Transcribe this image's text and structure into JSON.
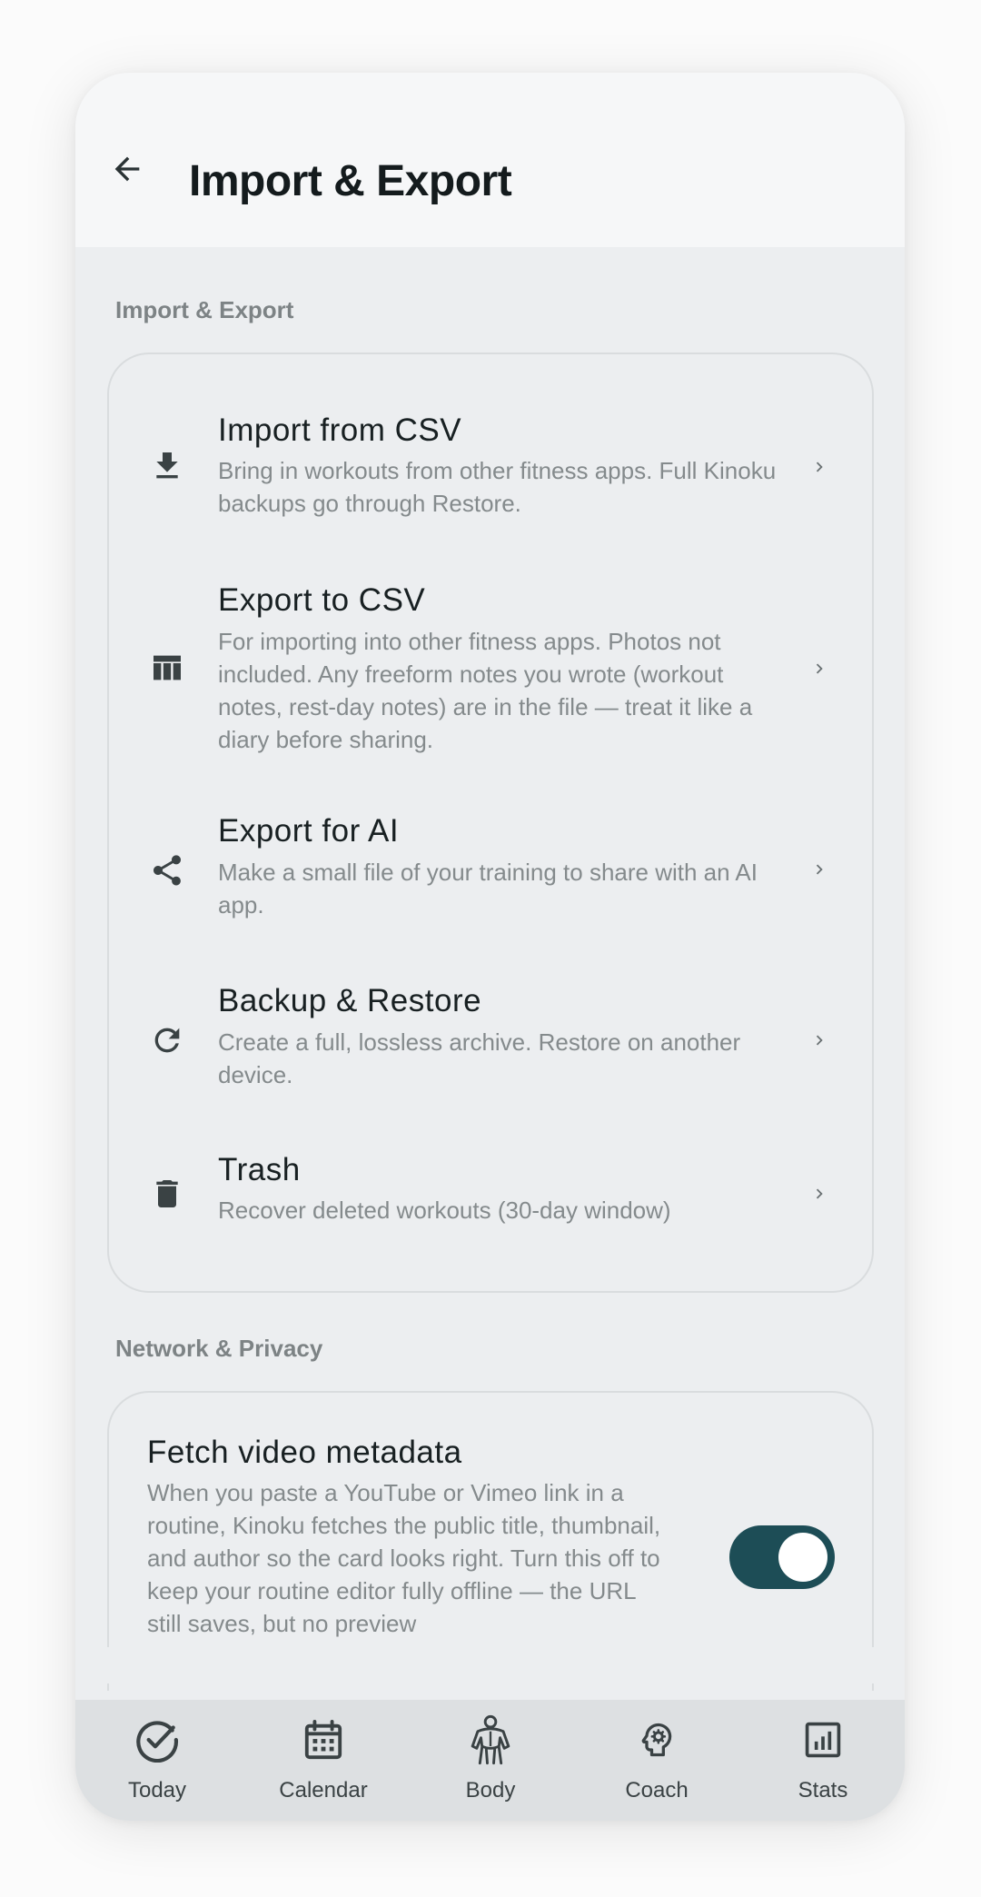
{
  "header": {
    "title": "Import & Export",
    "back_icon": "arrow-back-icon"
  },
  "sections": {
    "import_export_label": "Import & Export",
    "network_privacy_label": "Network & Privacy"
  },
  "rows": [
    {
      "icon": "download-icon",
      "title": "Import from CSV",
      "desc": "Bring in workouts from other fitness apps. Full Kinoku backups go through Restore."
    },
    {
      "icon": "table-icon",
      "title": "Export to CSV",
      "desc": "For importing into other fitness apps. Photos not included. Any freeform notes you wrote (workout notes, rest-day notes) are in the file — treat it like a diary before sharing."
    },
    {
      "icon": "share-icon",
      "title": "Export for AI",
      "desc": "Make a small file of your training to share with an AI app."
    },
    {
      "icon": "refresh-icon",
      "title": "Backup & Restore",
      "desc": "Create a full, lossless archive. Restore on another device."
    },
    {
      "icon": "trash-icon",
      "title": "Trash",
      "desc": "Recover deleted workouts (30-day window)"
    }
  ],
  "privacy": {
    "title": "Fetch video metadata",
    "desc": "When you paste a YouTube or Vimeo link in a routine, Kinoku fetches the public title, thumbnail, and author so the card looks right. Turn this off to keep your routine editor fully offline — the URL still saves, but no preview",
    "toggle_on": true
  },
  "nav": [
    {
      "icon": "check-circle-icon",
      "label": "Today"
    },
    {
      "icon": "calendar-icon",
      "label": "Calendar"
    },
    {
      "icon": "body-icon",
      "label": "Body"
    },
    {
      "icon": "coach-icon",
      "label": "Coach"
    },
    {
      "icon": "stats-icon",
      "label": "Stats"
    }
  ],
  "colors": {
    "accent": "#1d4d56",
    "background": "#eceef0",
    "muted_text": "#848a8c"
  }
}
